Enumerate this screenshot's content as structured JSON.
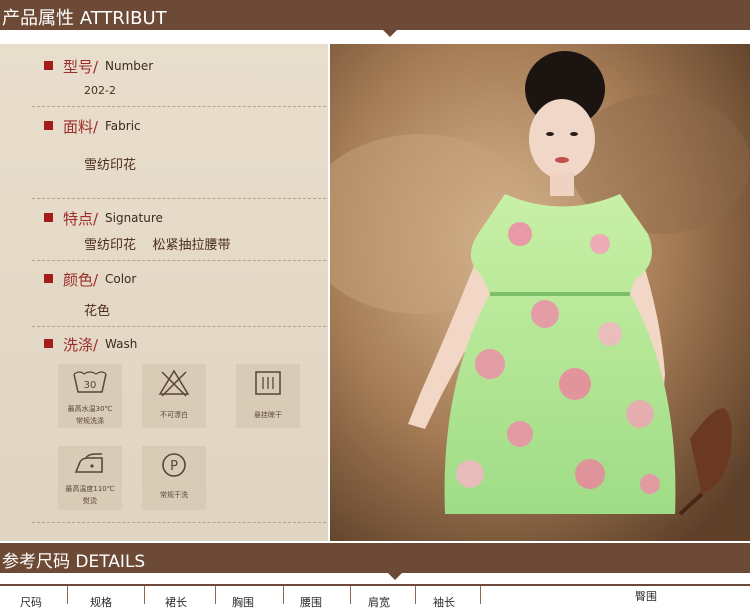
{
  "section1": {
    "title": "产品属性  ATTRIBUT"
  },
  "section2": {
    "title": "参考尺码 DETAILS"
  },
  "attributes": [
    {
      "zh": "型号/",
      "en": "Number",
      "value": "202-2"
    },
    {
      "zh": "面料/",
      "en": "Fabric",
      "value": "雪纺印花"
    },
    {
      "zh": "特点/",
      "en": "Signature",
      "value": "雪纺印花    松紧抽拉腰带"
    },
    {
      "zh": "颜色/",
      "en": "Color",
      "value": "花色"
    },
    {
      "zh": "洗涤/",
      "en": "Wash",
      "value": ""
    }
  ],
  "wash_icons": [
    {
      "icon": "wash-30-icon",
      "label1": "最高水温30℃",
      "label2": "常规洗涤"
    },
    {
      "icon": "no-bleach-icon",
      "label1": "不可漂白",
      "label2": ""
    },
    {
      "icon": "hang-dry-icon",
      "label1": "悬挂晾干",
      "label2": ""
    },
    {
      "icon": "iron-110-icon",
      "label1": "最高温度110℃",
      "label2": "熨烫"
    },
    {
      "icon": "dry-clean-p-icon",
      "label1": "常规干洗",
      "label2": ""
    }
  ],
  "size_table": {
    "headers": [
      "尺码",
      "规格",
      "裙长",
      "胸围",
      "腰围",
      "肩宽",
      "袖长",
      "臀围"
    ]
  },
  "colors": {
    "bar": "#6d4a36",
    "accent_red": "#a51c1c",
    "panel": "#e7dbc8"
  }
}
